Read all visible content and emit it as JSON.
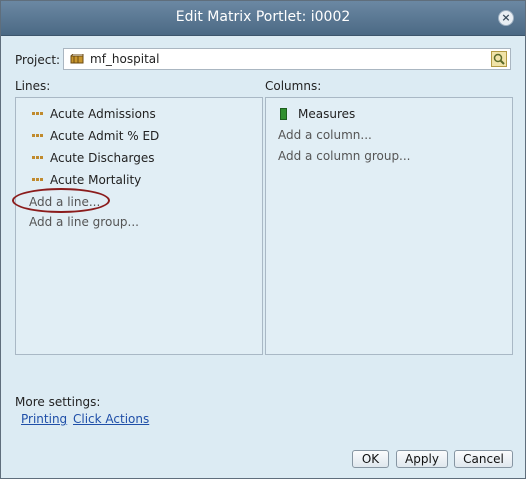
{
  "dialog": {
    "title": "Edit Matrix Portlet: i0002",
    "close_glyph": "×"
  },
  "project": {
    "label": "Project:",
    "value": "mf_hospital",
    "icon": "cube-icon",
    "browse_icon": "search-icon"
  },
  "lines": {
    "label": "Lines:",
    "items": [
      {
        "label": "Acute Admissions",
        "icon": "measure-dots-icon"
      },
      {
        "label": "Acute Admit % ED",
        "icon": "measure-dots-icon"
      },
      {
        "label": "Acute Discharges",
        "icon": "measure-dots-icon"
      },
      {
        "label": "Acute Mortality",
        "icon": "measure-dots-icon"
      }
    ],
    "add_line": "Add a line...",
    "add_line_group": "Add a line group..."
  },
  "columns": {
    "label": "Columns:",
    "items": [
      {
        "label": "Measures",
        "icon": "measures-group-icon"
      }
    ],
    "add_column": "Add a column...",
    "add_column_group": "Add a column group..."
  },
  "more_settings": {
    "label": "More settings:",
    "links": [
      "Printing",
      "Click Actions"
    ]
  },
  "buttons": {
    "ok": "OK",
    "apply": "Apply",
    "cancel": "Cancel"
  },
  "colors": {
    "titlebar": "#4b6984",
    "dialog_bg": "#dcebf3",
    "panel_bg": "#e1eef5",
    "link": "#1f4fa8",
    "highlight": "#8b1c1c"
  }
}
